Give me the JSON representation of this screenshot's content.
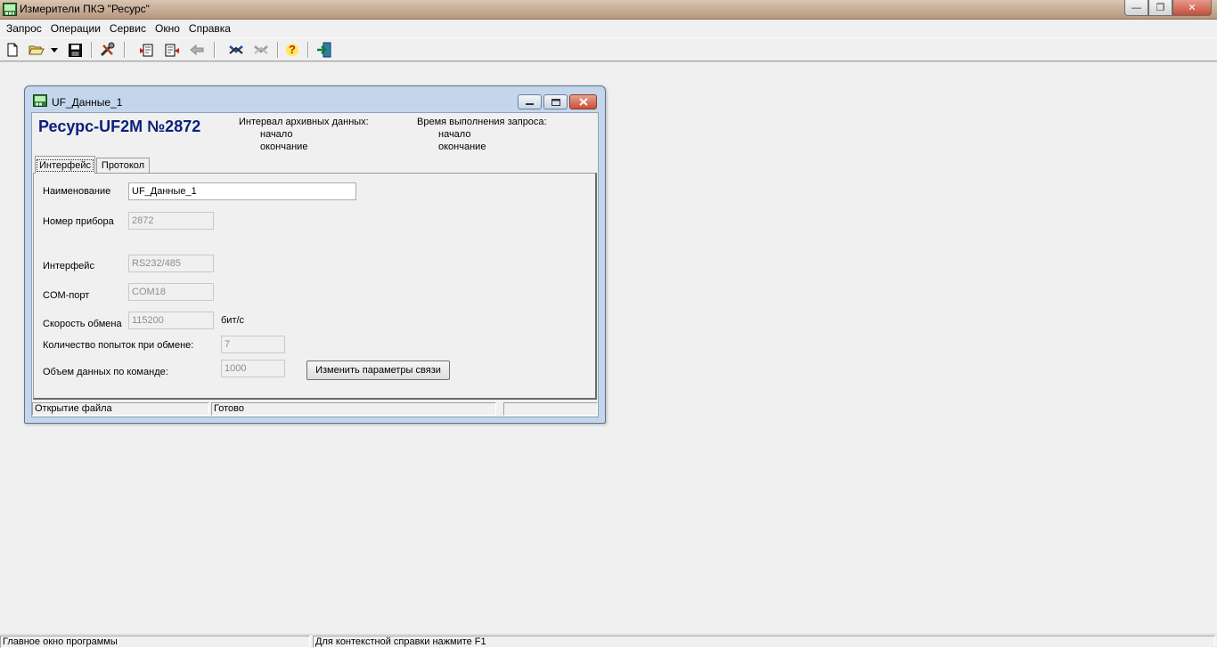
{
  "app": {
    "title": "Измерители ПКЭ \"Ресурс\"",
    "minimize_glyph": "—",
    "restore_glyph": "❐",
    "close_glyph": "✕"
  },
  "menu": {
    "items": [
      "Запрос",
      "Операции",
      "Сервис",
      "Окно",
      "Справка"
    ]
  },
  "toolbar": {
    "icons": [
      "new-file-icon",
      "open-folder-icon",
      "dropdown-arrow-icon",
      "save-icon",
      "tools-icon",
      "request-icon",
      "read-icon",
      "disabled-action-icon",
      "connect-icon",
      "disconnect-icon",
      "help-icon",
      "exit-icon"
    ],
    "help_glyph": "?"
  },
  "child_window": {
    "title": "UF_Данные_1",
    "device_title": "Ресурс-UF2M №2872",
    "archive_interval_label": "Интервал архивных данных:",
    "archive_start_label": "начало",
    "archive_end_label": "окончание",
    "request_time_label": "Время выполнения запроса:",
    "request_start_label": "начало",
    "request_end_label": "окончание",
    "tabs": [
      "Интерфейс",
      "Протокол"
    ],
    "active_tab": 0,
    "fields": {
      "name_label": "Наименование",
      "name_value": "UF_Данные_1",
      "device_number_label": "Номер прибора",
      "device_number_value": "2872",
      "interface_label": "Интерфейс",
      "interface_value": "RS232/485",
      "com_port_label": "COM-порт",
      "com_port_value": "COM18",
      "baud_label": "Скорость обмена",
      "baud_value": "115200",
      "baud_unit": "бит/с",
      "retries_label": "Количество попыток при обмене:",
      "retries_value": "7",
      "data_volume_label": "Объем данных по команде:",
      "data_volume_value": "1000",
      "change_params_button": "Изменить параметры связи"
    },
    "status": {
      "pane1": "Открытие файла",
      "pane2": "Готово",
      "pane3": ""
    }
  },
  "statusbar": {
    "left": "Главное окно программы",
    "right": "Для контекстной справки нажмите F1"
  },
  "colors": {
    "device_title": "#0a1f7a",
    "child_frame": "#c3d6ec",
    "app_title_bar": "#c9b09a",
    "close_button": "#c54e36"
  }
}
